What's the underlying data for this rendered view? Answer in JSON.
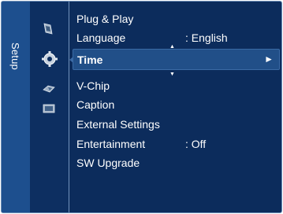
{
  "osd": {
    "tab_label": "Setup",
    "icons": [
      "picture-icon",
      "setup-gear-icon",
      "input-icon",
      "application-icon"
    ],
    "menu_items": [
      {
        "label": "Plug & Play",
        "value": ""
      },
      {
        "label": "Language",
        "value": ": English"
      },
      {
        "label": "V-Chip",
        "value": ""
      },
      {
        "label": "Caption",
        "value": ""
      },
      {
        "label": "External Settings",
        "value": ""
      },
      {
        "label": "Entertainment",
        "value": ": Off"
      },
      {
        "label": "SW Upgrade",
        "value": ""
      }
    ],
    "selected": {
      "label": "Time",
      "arrow": "►"
    },
    "scroll_up": "▲",
    "scroll_down": "▼"
  },
  "colors": {
    "panel": "#0c2c5c",
    "tab": "#1d4f8e",
    "highlight": "#214f88",
    "border": "#6d8fb8"
  }
}
